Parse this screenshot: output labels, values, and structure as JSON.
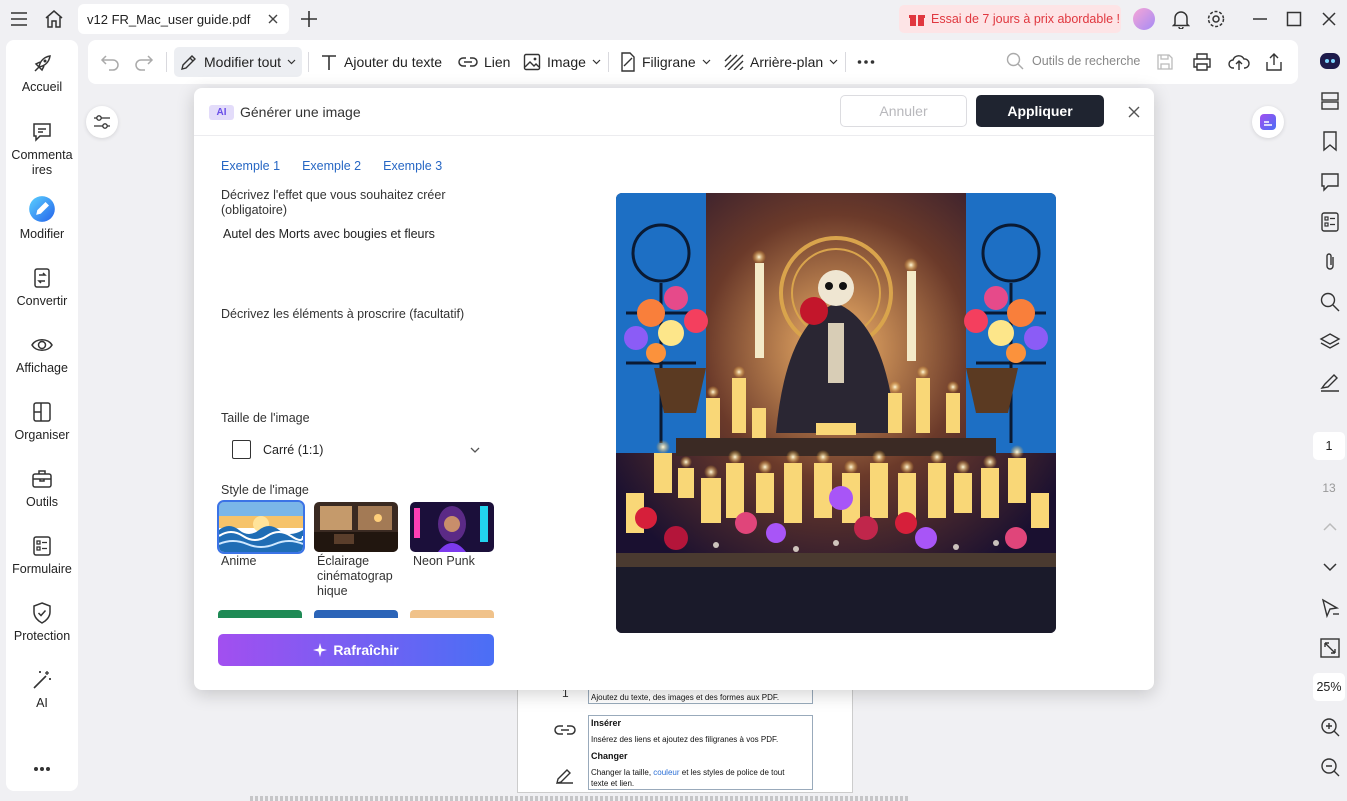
{
  "titlebar": {
    "tab_title": "v12 FR_Mac_user guide.pdf",
    "promo_text": "Essai de 7 jours à prix abordable !"
  },
  "sidebar": {
    "items": [
      {
        "label": "Accueil",
        "icon": "rocket-icon"
      },
      {
        "label": "Commentaires",
        "icon": "comment-icon"
      },
      {
        "label": "Modifier",
        "icon": "edit-icon"
      },
      {
        "label": "Convertir",
        "icon": "convert-icon"
      },
      {
        "label": "Affichage",
        "icon": "eye-icon"
      },
      {
        "label": "Organiser",
        "icon": "organize-icon"
      },
      {
        "label": "Outils",
        "icon": "toolbox-icon"
      },
      {
        "label": "Formulaire",
        "icon": "form-icon"
      },
      {
        "label": "Protection",
        "icon": "shield-icon"
      },
      {
        "label": "AI",
        "icon": "magic-wand-icon"
      }
    ],
    "comment_line1": "Commenta",
    "comment_line2": "ires"
  },
  "toolbar": {
    "edit_all": "Modifier tout",
    "add_text": "Ajouter du texte",
    "link": "Lien",
    "image": "Image",
    "watermark": "Filigrane",
    "background": "Arrière-plan",
    "search_placeholder": "Outils de recherche"
  },
  "rightbar": {
    "page_current": "1",
    "page_total": "13",
    "zoom": "25%"
  },
  "pdf": {
    "line_top": "Ajoutez du texte, des images et des formes aux PDF.",
    "insert_head": "Insérer",
    "insert_text": "Insérez des liens et ajoutez des filigranes à vos PDF.",
    "change_head": "Changer",
    "change_text_a": "Changer la taille, ",
    "change_link": "couleur",
    "change_text_b": " et les styles de police de tout",
    "change_text_c": "texte et lien.",
    "left_digit": "1"
  },
  "dialog": {
    "badge": "AI",
    "title": "Générer une image",
    "cancel": "Annuler",
    "apply": "Appliquer",
    "examples": [
      "Exemple 1",
      "Exemple 2",
      "Exemple 3"
    ],
    "describe_label": "Décrivez l'effet que vous souhaitez créer (obligatoire)",
    "describe_value": "Autel des Morts avec bougies et fleurs",
    "negative_label": "Décrivez les éléments à proscrire (facultatif)",
    "negative_value": "",
    "size_label": "Taille de l'image",
    "size_value": "Carré (1:1)",
    "style_label": "Style de l'image",
    "styles": [
      {
        "label": "Anime",
        "selected": true
      },
      {
        "label": "Éclairage cinématographique",
        "selected": false
      },
      {
        "label": "Neon Punk",
        "selected": false
      }
    ],
    "style2_line1": "Éclairage",
    "style2_line2": "cinématograp",
    "style2_line3": "hique",
    "refresh": "Rafraîchir"
  },
  "colors": {
    "accent": "#1f2430",
    "link": "#2767c4",
    "promo": "#e0373f",
    "refresh_gradient_start": "#a24ff0",
    "refresh_gradient_end": "#4a6ff5"
  }
}
